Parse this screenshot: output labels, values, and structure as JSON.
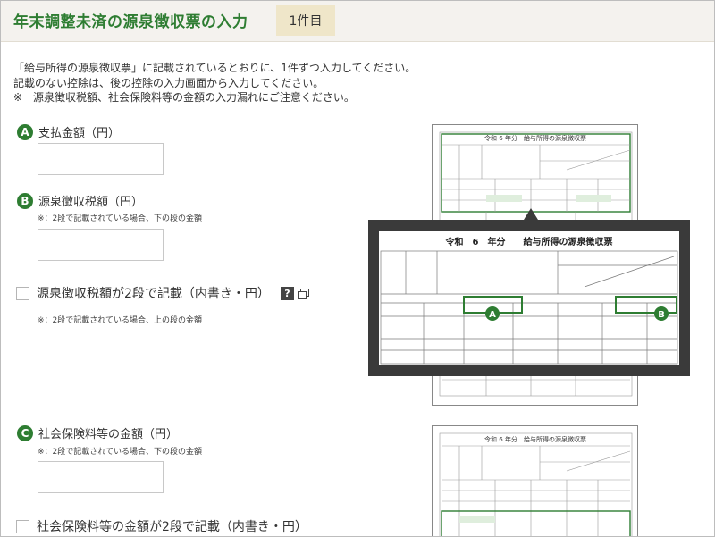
{
  "header": {
    "title": "年末調整未済の源泉徴収票の入力",
    "count": "1件目"
  },
  "intro": [
    "「給与所得の源泉徴収票」に記載されているとおりに、1件ずつ入力してください。",
    "記載のない控除は、後の控除の入力画面から入力してください。",
    "※　源泉徴収税額、社会保険料等の金額の入力漏れにご注意ください。"
  ],
  "fields": {
    "a": {
      "marker": "A",
      "label": "支払金額（円）",
      "value": "",
      "placeholder": ""
    },
    "b": {
      "marker": "B",
      "label": "源泉徴収税額（円）",
      "note": "※：2段で記載されている場合、下の段の金額",
      "value": "",
      "placeholder": ""
    },
    "b_check": {
      "label": "源泉徴収税額が2段で記載（内書き・円）",
      "help": "?",
      "note": "※：2段で記載されている場合、上の段の金額"
    },
    "c": {
      "marker": "C",
      "label": "社会保険料等の金額（円）",
      "note": "※：2段で記載されている場合、下の段の金額",
      "value": "",
      "placeholder": ""
    },
    "c_check": {
      "label": "社会保険料等の金額が2段で記載（内書き・円）"
    }
  },
  "form_image": {
    "heading": "令和 6 年分　給与所得の源泉徴収票",
    "zoom_heading": "令和　6　年分　　給与所得の源泉徴収票",
    "marker_a": "A",
    "marker_b": "B"
  },
  "colors": {
    "accent": "#2e7d32",
    "header_bg": "#f4f2ee",
    "badge_bg": "#efe6c9",
    "zoom_frame": "#3a3a3a"
  },
  "icons": [
    "help-icon",
    "popup-window-icon"
  ]
}
